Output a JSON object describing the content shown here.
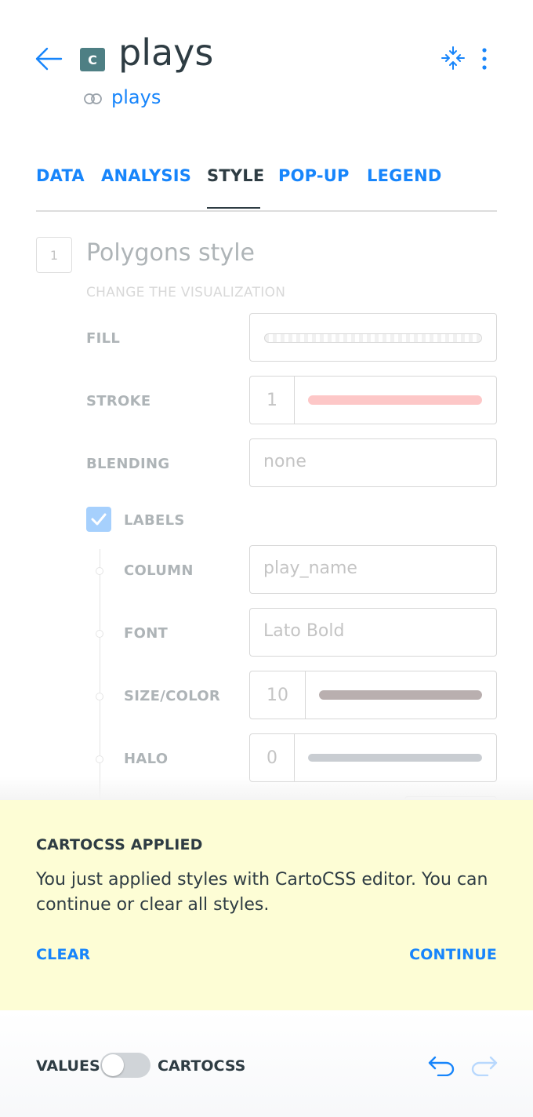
{
  "header": {
    "layer_letter": "C",
    "layer_name": "plays",
    "source_name": "plays"
  },
  "tabs": [
    {
      "label": "DATA",
      "active": false
    },
    {
      "label": "ANALYSIS",
      "active": false
    },
    {
      "label": "STYLE",
      "active": true
    },
    {
      "label": "POP-UP",
      "active": false
    },
    {
      "label": "LEGEND",
      "active": false
    }
  ],
  "style_panel": {
    "step_number": "1",
    "title": "Polygons style",
    "subtitle": "CHANGE THE VISUALIZATION",
    "fill_label": "FILL",
    "stroke_label": "STROKE",
    "stroke_width": "1",
    "stroke_color": "#fa6f6f",
    "blending_label": "BLENDING",
    "blending_value": "none",
    "labels_label": "LABELS",
    "labels_checked": true,
    "column_label": "COLUMN",
    "column_value": "play_name",
    "font_label": "FONT",
    "font_value": "Lato Bold",
    "size_color_label": "SIZE/COLOR",
    "size_value": "10",
    "size_color": "#4a2f2f",
    "halo_label": "HALO",
    "halo_value": "0",
    "halo_color": "#747d8c"
  },
  "notice": {
    "title": "CARTOCSS APPLIED",
    "body": "You just applied styles with CartoCSS editor. You can continue or clear all styles.",
    "clear_label": "CLEAR",
    "continue_label": "CONTINUE"
  },
  "footer": {
    "values_label": "VALUES",
    "cartocss_label": "CARTOCSS",
    "toggle_on": false
  },
  "colors": {
    "accent": "#1785fb",
    "text": "#2e3c43",
    "notice_bg": "#fdfdd5",
    "layer_badge": "#4e7f84"
  }
}
